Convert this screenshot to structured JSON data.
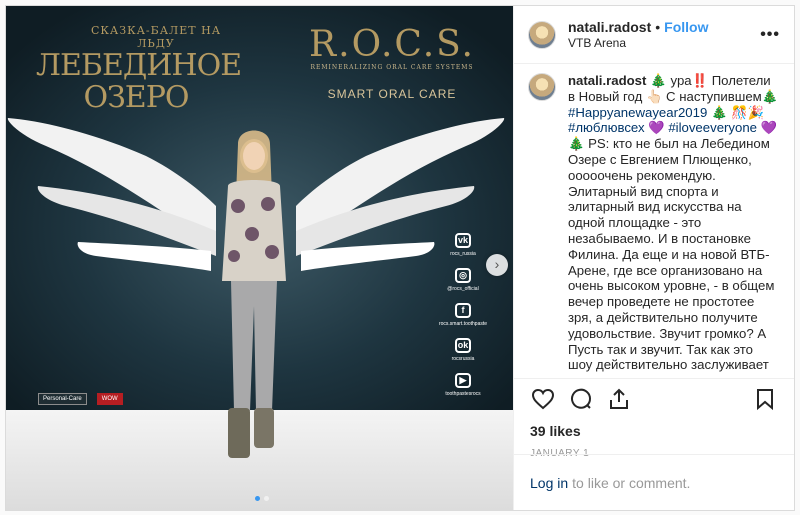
{
  "poster": {
    "subtitle": "СКАЗКА-БАЛЕТ НА ЛЬДУ",
    "title_line1": "ЛЕБЕДИНОЕ",
    "title_line2": "ОЗЕРО",
    "brand": "R.O.C.S.",
    "brand_tagline": "REMINERALIZING ORAL CARE SYSTEMS",
    "brand_slogan": "SMART ORAL CARE",
    "social": [
      {
        "glyph": "vk",
        "text": "rocs_russia"
      },
      {
        "glyph": "◎",
        "text": "@rocs_official"
      },
      {
        "glyph": "f",
        "text": "rocs.smart.toothpaste"
      },
      {
        "glyph": "ok",
        "text": "rocsrussia"
      },
      {
        "glyph": "▶",
        "text": "toothpastesrocs"
      }
    ],
    "store_logos": [
      "Personal-Care",
      "WOW"
    ]
  },
  "carousel": {
    "current": 1,
    "total": 2
  },
  "colors": {
    "link": "#3897f0",
    "hashtag": "#003569",
    "text": "#262626",
    "muted": "#999999",
    "poster_gold": "#b49a62"
  },
  "header": {
    "username": "natali.radost",
    "separator": "•",
    "follow_label": "Follow",
    "location": "VTB Arena",
    "more_icon": "more-horizontal-icon"
  },
  "caption": {
    "username": "natali.radost",
    "segments": [
      {
        "text": "🎄 ура‼️ Полетели в Новый год 👆🏻 С наступившем🎄 ",
        "tag": false
      },
      {
        "text": "#Happyanewayear2019",
        "tag": true
      },
      {
        "text": " 🎄 🎊🎉 ",
        "tag": false
      },
      {
        "text": "#люблювсех",
        "tag": true
      },
      {
        "text": " 💜 ",
        "tag": false
      },
      {
        "text": "#iloveeveryone",
        "tag": true
      },
      {
        "text": " 💜\n🎄 PS: кто не был на Лебедином Озере с Евгением Плющенко, ооооочень рекомендую. Элитарный вид спорта и элитарный вид искусства на одной площадке - это незабываемо. И в постановке Филина. Да еще и на новой ВТБ-Арене, где все организовано на очень высоком уровне, - в общем вечер проведете не простотее зря, а действительно получите удовольствие. Звучит громко? А Пусть так и звучит. Так как это шоу действительно заслуживает самых громких аплодисментов.",
        "tag": false
      }
    ]
  },
  "actions": {
    "icons": [
      "heart-icon",
      "comment-icon",
      "share-icon",
      "bookmark-icon"
    ],
    "likes": "39 likes",
    "date": "JANUARY 1"
  },
  "footer": {
    "login_label": "Log in",
    "suffix": "to like or comment."
  }
}
